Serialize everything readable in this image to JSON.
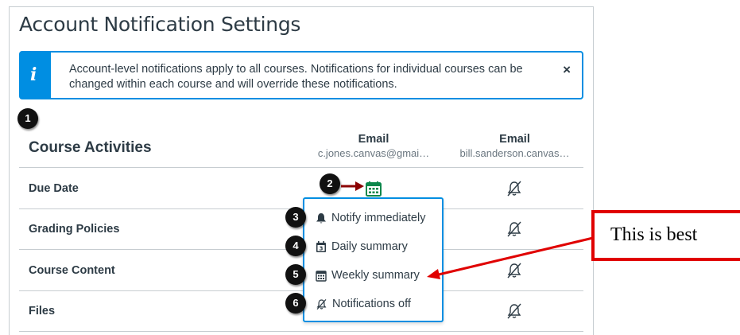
{
  "page": {
    "title": "Account Notification Settings"
  },
  "alert": {
    "text": "Account-level notifications apply to all courses. Notifications for individual courses can be changed within each course and will override these notifications.",
    "close": "×",
    "icon": "info-icon"
  },
  "section": {
    "title": "Course Activities"
  },
  "columns": [
    {
      "label": "Email",
      "address": "c.jones.canvas@gmai…"
    },
    {
      "label": "Email",
      "address": "bill.sanderson.canvas…"
    }
  ],
  "rows": [
    {
      "label": "Due Date"
    },
    {
      "label": "Grading Policies"
    },
    {
      "label": "Course Content"
    },
    {
      "label": "Files"
    }
  ],
  "menu": {
    "items": [
      {
        "label": "Notify immediately",
        "icon": "bell-icon"
      },
      {
        "label": "Daily summary",
        "icon": "calendar-day-icon"
      },
      {
        "label": "Weekly summary",
        "icon": "calendar-month-icon"
      },
      {
        "label": "Notifications off",
        "icon": "bell-off-icon"
      }
    ]
  },
  "badges": [
    "1",
    "2",
    "3",
    "4",
    "5",
    "6"
  ],
  "callout": {
    "text": "This is best"
  },
  "colors": {
    "accent": "#008ee2",
    "selected_icon": "#0b874b",
    "annotation_red": "#e00000",
    "arrow_dark_red": "#8b0000"
  }
}
